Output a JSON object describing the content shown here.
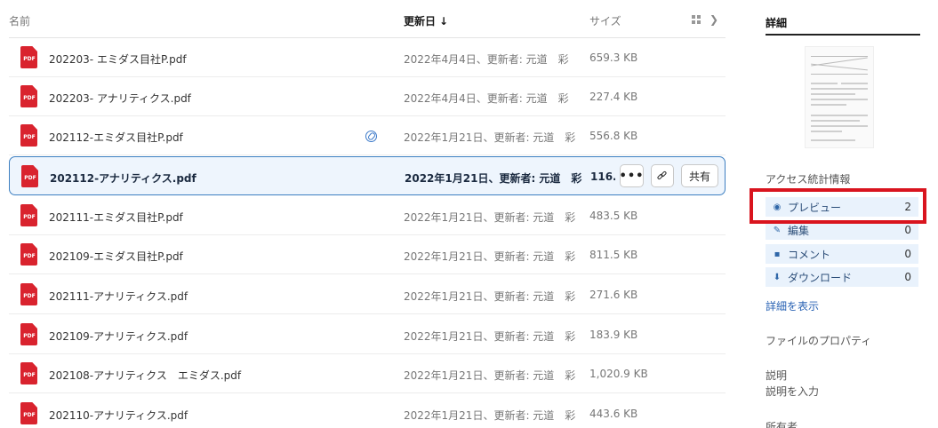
{
  "list": {
    "columns": {
      "name": "名前",
      "date": "更新日",
      "date_sort": "↓",
      "size": "サイズ"
    },
    "rows": [
      {
        "name": "202203- エミダス目社P.pdf",
        "date": "2022年4月4日、更新者: 元道　彩",
        "size": "659.3 KB"
      },
      {
        "name": "202203- アナリティクス.pdf",
        "date": "2022年4月4日、更新者: 元道　彩",
        "size": "227.4 KB"
      },
      {
        "name": "202112-エミダス目社P.pdf",
        "date": "2022年1月21日、更新者: 元道　彩",
        "size": "556.8 KB"
      },
      {
        "name": "202112-アナリティクス.pdf",
        "date": "2022年1月21日、更新者: 元道　彩",
        "size": "116.8"
      },
      {
        "name": "202111-エミダス目社P.pdf",
        "date": "2022年1月21日、更新者: 元道　彩",
        "size": "483.5 KB"
      },
      {
        "name": "202109-エミダス目社P.pdf",
        "date": "2022年1月21日、更新者: 元道　彩",
        "size": "811.5 KB"
      },
      {
        "name": "202111-アナリティクス.pdf",
        "date": "2022年1月21日、更新者: 元道　彩",
        "size": "271.6 KB"
      },
      {
        "name": "202109-アナリティクス.pdf",
        "date": "2022年1月21日、更新者: 元道　彩",
        "size": "183.9 KB"
      },
      {
        "name": "202108-アナリティクス　エミダス.pdf",
        "date": "2022年1月21日、更新者: 元道　彩",
        "size": "1,020.9 KB"
      },
      {
        "name": "202110-アナリティクス.pdf",
        "date": "2022年1月21日、更新者: 元道　彩",
        "size": "443.6 KB"
      }
    ],
    "file_icon_label": "PDF",
    "row_actions": {
      "more": "•••",
      "share": "共有"
    }
  },
  "panel": {
    "title": "詳細",
    "stats_title": "アクセス統計情報",
    "stats": [
      {
        "label": "プレビュー",
        "value": "2"
      },
      {
        "label": "編集",
        "value": "0"
      },
      {
        "label": "コメント",
        "value": "0"
      },
      {
        "label": "ダウンロード",
        "value": "0"
      }
    ],
    "show_details": "詳細を表示",
    "properties_title": "ファイルのプロパティ",
    "description_label": "説明",
    "description_placeholder": "説明を入力",
    "owner_label": "所有者"
  },
  "colors": {
    "accent": "#3d7fc1",
    "pdf": "#d9232e",
    "highlight": "#d9141e",
    "stat_bg": "#e9f2fc"
  }
}
